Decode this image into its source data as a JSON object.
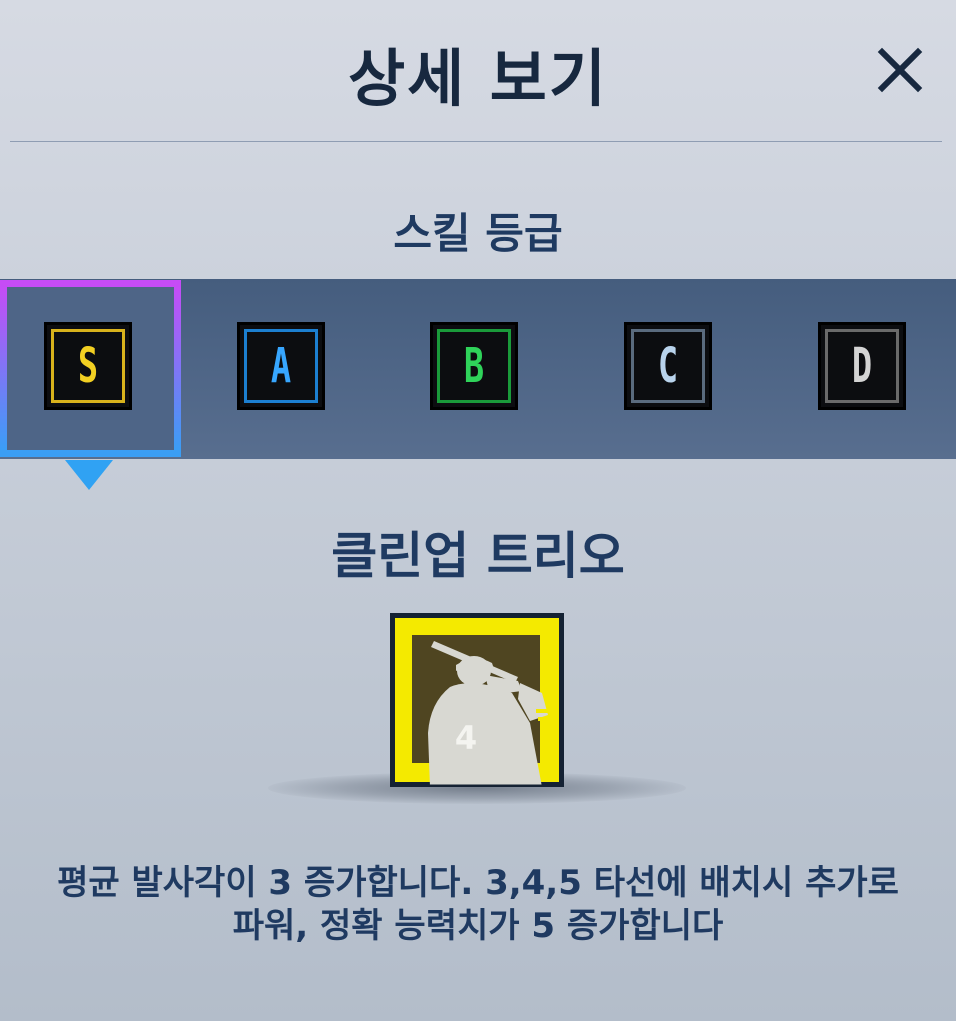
{
  "header": {
    "title": "상세 보기",
    "close_icon": "close-icon"
  },
  "grade_section": {
    "label": "스킬 등급",
    "selected": "S",
    "grades": [
      {
        "letter": "S",
        "frame_color": "#d8b21c",
        "text_color": "#f2cf22"
      },
      {
        "letter": "A",
        "frame_color": "#1c7fd0",
        "text_color": "#37a6ff"
      },
      {
        "letter": "B",
        "frame_color": "#1a9a3a",
        "text_color": "#2fd35a"
      },
      {
        "letter": "C",
        "frame_color": "#5a6b7e",
        "text_color": "#b9d3ec"
      },
      {
        "letter": "D",
        "frame_color": "#6a6a6a",
        "text_color": "#d4d4d4"
      }
    ]
  },
  "skill": {
    "name": "클린업 트리오",
    "icon": "batter-icon",
    "icon_number": "4",
    "description_line1": "평균 발사각이 3 증가합니다. 3,4,5 타선에 배치시 추가로",
    "description_line2": "파워, 정확 능력치가 5 증가합니다"
  }
}
